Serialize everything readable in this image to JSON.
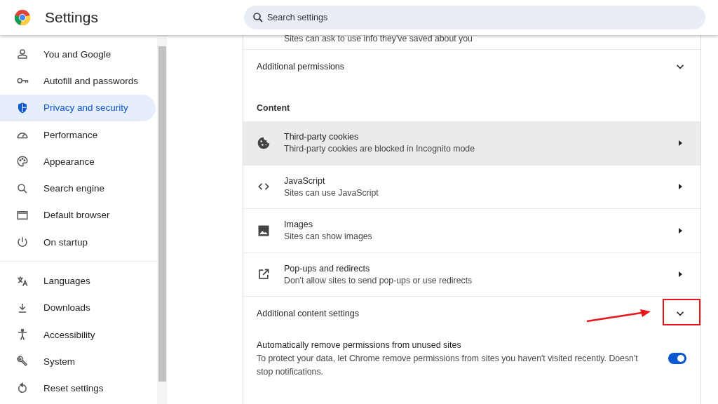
{
  "header": {
    "title": "Settings",
    "search": {
      "placeholder": "Search settings"
    }
  },
  "sidebar": {
    "groups": [
      {
        "items": [
          {
            "label": "You and Google",
            "kind": "person",
            "selected": false
          },
          {
            "label": "Autofill and passwords",
            "kind": "key",
            "selected": false
          },
          {
            "label": "Privacy and security",
            "kind": "shield",
            "selected": true
          },
          {
            "label": "Performance",
            "kind": "gauge",
            "selected": false
          },
          {
            "label": "Appearance",
            "kind": "palette",
            "selected": false
          },
          {
            "label": "Search engine",
            "kind": "search",
            "selected": false
          },
          {
            "label": "Default browser",
            "kind": "browser",
            "selected": false
          },
          {
            "label": "On startup",
            "kind": "power",
            "selected": false
          }
        ]
      },
      {
        "items": [
          {
            "label": "Languages",
            "kind": "translate",
            "selected": false
          },
          {
            "label": "Downloads",
            "kind": "download",
            "selected": false
          },
          {
            "label": "Accessibility",
            "kind": "accessibility",
            "selected": false
          },
          {
            "label": "System",
            "kind": "wrench",
            "selected": false
          },
          {
            "label": "Reset settings",
            "kind": "reset",
            "selected": false
          }
        ]
      }
    ]
  },
  "main": {
    "partial_line": "Sites can ask to use info they've saved about you",
    "rows": [
      {
        "kind": "expand",
        "label": "Additional permissions",
        "expanded": false
      },
      {
        "kind": "heading",
        "label": "Content"
      },
      {
        "kind": "link",
        "label": "Third-party cookies",
        "sublabel": "Third-party cookies are blocked in Incognito mode",
        "hovered": true
      },
      {
        "kind": "link",
        "label": "JavaScript",
        "sublabel": "Sites can use JavaScript",
        "hovered": false
      },
      {
        "kind": "link",
        "label": "Images",
        "sublabel": "Sites can show images",
        "hovered": false
      },
      {
        "kind": "link",
        "label": "Pop-ups and redirects",
        "sublabel": "Don't allow sites to send pop-ups or use redirects",
        "hovered": false
      },
      {
        "kind": "expand",
        "label": "Additional content settings",
        "expanded": false,
        "highlighted": true
      },
      {
        "kind": "toggle",
        "label": "Automatically remove permissions from unused sites",
        "sublabel": "To protect your data, let Chrome remove permissions from sites you haven't visited recently. Doesn't stop notifications.",
        "on": true
      }
    ]
  }
}
